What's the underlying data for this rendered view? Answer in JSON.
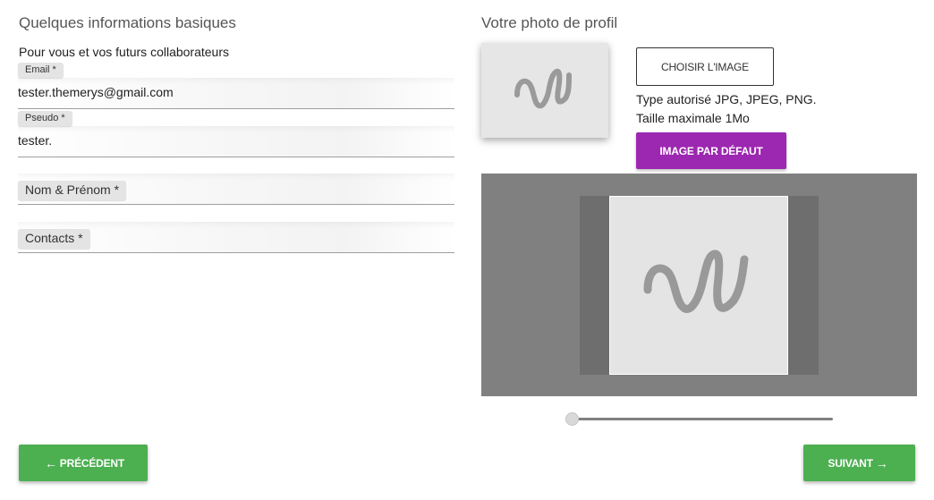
{
  "left": {
    "title": "Quelques informations basiques",
    "subtitle": "Pour vous et vos futurs collaborateurs",
    "fields": {
      "email": {
        "label": "Email *",
        "value": "tester.themerys@gmail.com"
      },
      "pseudo": {
        "label": "Pseudo *",
        "value": "tester."
      },
      "name": {
        "label": "Nom & Prénom *",
        "value": ""
      },
      "contacts": {
        "label": "Contacts *",
        "value": ""
      }
    }
  },
  "right": {
    "title": "Votre photo de profil",
    "choose_button": "CHOISIR L'IMAGE",
    "allowed_types": "Type autorisé JPG, JPEG, PNG.",
    "max_size": "Taille maximale 1Mo",
    "default_button": "IMAGE PAR DÉFAUT",
    "zoom_level": 0
  },
  "footer": {
    "prev_label": "PRÉCÉDENT",
    "next_label": "SUIVANT"
  },
  "colors": {
    "purple": "#9c27b0",
    "green": "#4caf50",
    "cropper_bg": "#808080"
  },
  "icons": {
    "prev": "arrow-left-icon",
    "next": "arrow-right-icon",
    "placeholder": "squiggle-icon"
  }
}
